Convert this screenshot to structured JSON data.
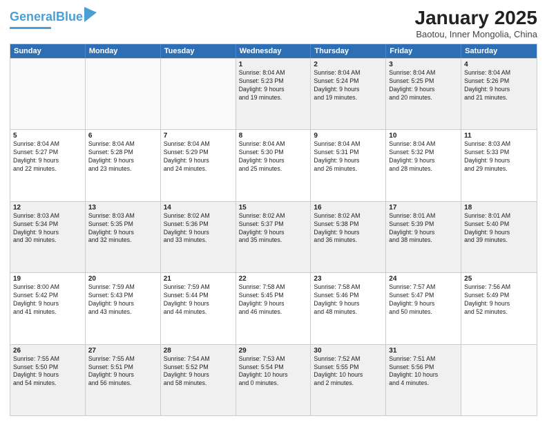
{
  "logo": {
    "text1": "General",
    "text2": "Blue"
  },
  "title": "January 2025",
  "subtitle": "Baotou, Inner Mongolia, China",
  "weekdays": [
    "Sunday",
    "Monday",
    "Tuesday",
    "Wednesday",
    "Thursday",
    "Friday",
    "Saturday"
  ],
  "weeks": [
    [
      {
        "day": "",
        "info": ""
      },
      {
        "day": "",
        "info": ""
      },
      {
        "day": "",
        "info": ""
      },
      {
        "day": "1",
        "info": "Sunrise: 8:04 AM\nSunset: 5:23 PM\nDaylight: 9 hours\nand 19 minutes."
      },
      {
        "day": "2",
        "info": "Sunrise: 8:04 AM\nSunset: 5:24 PM\nDaylight: 9 hours\nand 19 minutes."
      },
      {
        "day": "3",
        "info": "Sunrise: 8:04 AM\nSunset: 5:25 PM\nDaylight: 9 hours\nand 20 minutes."
      },
      {
        "day": "4",
        "info": "Sunrise: 8:04 AM\nSunset: 5:26 PM\nDaylight: 9 hours\nand 21 minutes."
      }
    ],
    [
      {
        "day": "5",
        "info": "Sunrise: 8:04 AM\nSunset: 5:27 PM\nDaylight: 9 hours\nand 22 minutes."
      },
      {
        "day": "6",
        "info": "Sunrise: 8:04 AM\nSunset: 5:28 PM\nDaylight: 9 hours\nand 23 minutes."
      },
      {
        "day": "7",
        "info": "Sunrise: 8:04 AM\nSunset: 5:29 PM\nDaylight: 9 hours\nand 24 minutes."
      },
      {
        "day": "8",
        "info": "Sunrise: 8:04 AM\nSunset: 5:30 PM\nDaylight: 9 hours\nand 25 minutes."
      },
      {
        "day": "9",
        "info": "Sunrise: 8:04 AM\nSunset: 5:31 PM\nDaylight: 9 hours\nand 26 minutes."
      },
      {
        "day": "10",
        "info": "Sunrise: 8:04 AM\nSunset: 5:32 PM\nDaylight: 9 hours\nand 28 minutes."
      },
      {
        "day": "11",
        "info": "Sunrise: 8:03 AM\nSunset: 5:33 PM\nDaylight: 9 hours\nand 29 minutes."
      }
    ],
    [
      {
        "day": "12",
        "info": "Sunrise: 8:03 AM\nSunset: 5:34 PM\nDaylight: 9 hours\nand 30 minutes."
      },
      {
        "day": "13",
        "info": "Sunrise: 8:03 AM\nSunset: 5:35 PM\nDaylight: 9 hours\nand 32 minutes."
      },
      {
        "day": "14",
        "info": "Sunrise: 8:02 AM\nSunset: 5:36 PM\nDaylight: 9 hours\nand 33 minutes."
      },
      {
        "day": "15",
        "info": "Sunrise: 8:02 AM\nSunset: 5:37 PM\nDaylight: 9 hours\nand 35 minutes."
      },
      {
        "day": "16",
        "info": "Sunrise: 8:02 AM\nSunset: 5:38 PM\nDaylight: 9 hours\nand 36 minutes."
      },
      {
        "day": "17",
        "info": "Sunrise: 8:01 AM\nSunset: 5:39 PM\nDaylight: 9 hours\nand 38 minutes."
      },
      {
        "day": "18",
        "info": "Sunrise: 8:01 AM\nSunset: 5:40 PM\nDaylight: 9 hours\nand 39 minutes."
      }
    ],
    [
      {
        "day": "19",
        "info": "Sunrise: 8:00 AM\nSunset: 5:42 PM\nDaylight: 9 hours\nand 41 minutes."
      },
      {
        "day": "20",
        "info": "Sunrise: 7:59 AM\nSunset: 5:43 PM\nDaylight: 9 hours\nand 43 minutes."
      },
      {
        "day": "21",
        "info": "Sunrise: 7:59 AM\nSunset: 5:44 PM\nDaylight: 9 hours\nand 44 minutes."
      },
      {
        "day": "22",
        "info": "Sunrise: 7:58 AM\nSunset: 5:45 PM\nDaylight: 9 hours\nand 46 minutes."
      },
      {
        "day": "23",
        "info": "Sunrise: 7:58 AM\nSunset: 5:46 PM\nDaylight: 9 hours\nand 48 minutes."
      },
      {
        "day": "24",
        "info": "Sunrise: 7:57 AM\nSunset: 5:47 PM\nDaylight: 9 hours\nand 50 minutes."
      },
      {
        "day": "25",
        "info": "Sunrise: 7:56 AM\nSunset: 5:49 PM\nDaylight: 9 hours\nand 52 minutes."
      }
    ],
    [
      {
        "day": "26",
        "info": "Sunrise: 7:55 AM\nSunset: 5:50 PM\nDaylight: 9 hours\nand 54 minutes."
      },
      {
        "day": "27",
        "info": "Sunrise: 7:55 AM\nSunset: 5:51 PM\nDaylight: 9 hours\nand 56 minutes."
      },
      {
        "day": "28",
        "info": "Sunrise: 7:54 AM\nSunset: 5:52 PM\nDaylight: 9 hours\nand 58 minutes."
      },
      {
        "day": "29",
        "info": "Sunrise: 7:53 AM\nSunset: 5:54 PM\nDaylight: 10 hours\nand 0 minutes."
      },
      {
        "day": "30",
        "info": "Sunrise: 7:52 AM\nSunset: 5:55 PM\nDaylight: 10 hours\nand 2 minutes."
      },
      {
        "day": "31",
        "info": "Sunrise: 7:51 AM\nSunset: 5:56 PM\nDaylight: 10 hours\nand 4 minutes."
      },
      {
        "day": "",
        "info": ""
      }
    ]
  ]
}
